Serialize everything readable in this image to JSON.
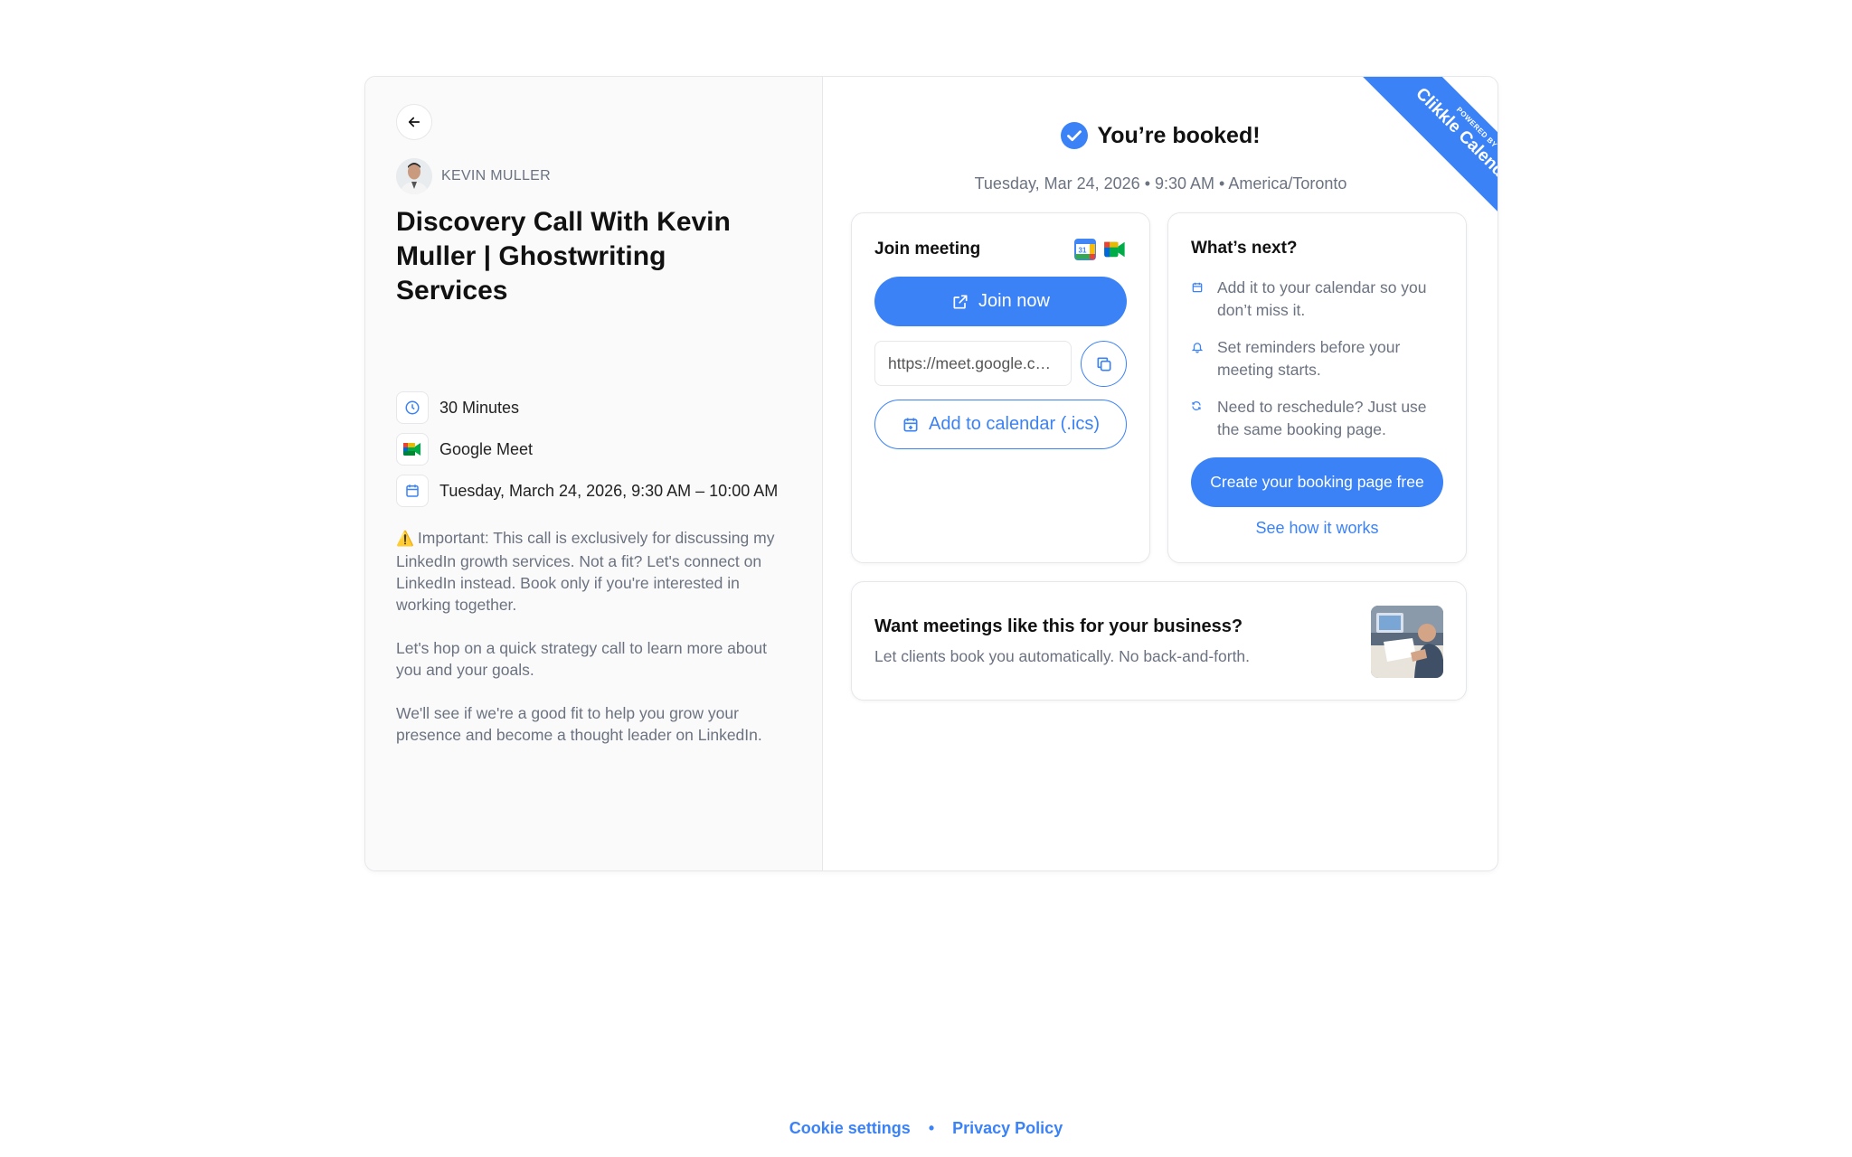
{
  "host": {
    "name": "KEVIN MULLER"
  },
  "event": {
    "title": "Discovery Call With Kevin Muller | Ghostwriting Services",
    "duration": "30 Minutes",
    "location": "Google Meet",
    "datetime": "Tuesday, March 24, 2026, 9:30 AM – 10:00 AM",
    "description": [
      "Important: This call is exclusively for discussing my LinkedIn growth services. Not a fit? Let's connect on LinkedIn instead. Book only if you're interested in working together.",
      "Let's hop on a quick strategy call to learn more about you and your goals.",
      "We'll see if we're a good fit to help you grow your presence and become a thought leader on LinkedIn."
    ]
  },
  "ribbon": {
    "small": "POWERED BY",
    "big": "Clikkle Calendar"
  },
  "confirmation": {
    "title": "You’re booked!",
    "date": "Tuesday, Mar 24, 2026 • 9:30 AM • America/Toronto"
  },
  "join": {
    "heading": "Join meeting",
    "join_label": "Join now",
    "link": "https://meet.google.com/",
    "ics_label": "Add to calendar (.ics)"
  },
  "next": {
    "heading": "What’s next?",
    "items": [
      "Add it to your calendar so you don’t miss it.",
      "Set reminders before your meeting starts.",
      "Need to reschedule? Just use the same booking page."
    ],
    "create_label": "Create your booking page free",
    "see_label": "See how it works"
  },
  "promo": {
    "title": "Want meetings like this for your business?",
    "subtitle": "Let clients book you automatically. No back-and-forth."
  },
  "footer": {
    "cookie": "Cookie settings",
    "separator": "•",
    "privacy": "Privacy Policy"
  },
  "colors": {
    "accent": "#3b82f6",
    "muted": "#6b7280",
    "border": "#e5e7eb",
    "left_bg": "#fafafa"
  }
}
